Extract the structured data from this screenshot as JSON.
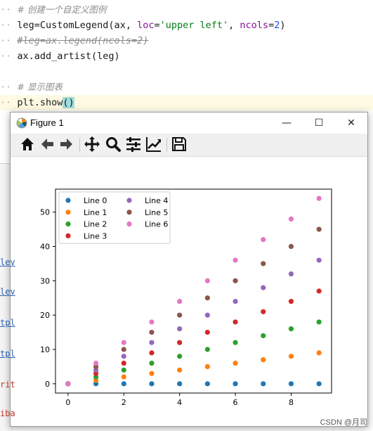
{
  "editor": {
    "lines": [
      {
        "dots": "··",
        "parts": [
          {
            "cls": "c-comment",
            "text": "# 创建一个自定义图例"
          }
        ]
      },
      {
        "dots": "··",
        "parts": [
          {
            "cls": "",
            "text": "leg=CustomLegend(ax, "
          },
          {
            "cls": "c-kw",
            "text": "loc"
          },
          {
            "cls": "",
            "text": "="
          },
          {
            "cls": "c-str",
            "text": "'upper left'"
          },
          {
            "cls": "",
            "text": ", "
          },
          {
            "cls": "c-kw",
            "text": "ncols"
          },
          {
            "cls": "",
            "text": "="
          },
          {
            "cls": "c-num",
            "text": "2"
          },
          {
            "cls": "",
            "text": ")"
          }
        ]
      },
      {
        "dots": "··",
        "parts": [
          {
            "cls": "c-struck",
            "text": "#leg=ax.legend(ncols=2)"
          }
        ]
      },
      {
        "dots": "··",
        "parts": [
          {
            "cls": "",
            "text": "ax.add_artist(leg)"
          }
        ]
      },
      {
        "dots": "",
        "parts": []
      },
      {
        "dots": "··",
        "parts": [
          {
            "cls": "c-comment",
            "text": "# 显示图表"
          }
        ]
      },
      {
        "dots": "··",
        "parts": [
          {
            "cls": "",
            "text": "plt.show"
          },
          {
            "cls": "hl-bg",
            "text": "()"
          }
        ]
      }
    ]
  },
  "side_snippets": [
    {
      "text": "lev",
      "color": "blue"
    },
    {
      "text": "lev",
      "color": "blue"
    },
    {
      "text": "tpl",
      "color": "blue"
    },
    {
      "text": "tpl",
      "color": "blue"
    },
    {
      "text": "rit",
      "color": "red"
    },
    {
      "text": "iba",
      "color": "red"
    }
  ],
  "window": {
    "title": "Figure 1",
    "minimize_label": "—",
    "maximize_label": "☐",
    "close_label": "✕",
    "toolbar_icons": [
      "home-icon",
      "back-arrow-icon",
      "forward-arrow-icon",
      "pan-icon",
      "zoom-icon",
      "subplots-config-icon",
      "edit-axis-icon",
      "save-icon"
    ]
  },
  "chart_data": {
    "type": "scatter",
    "title": "",
    "xlabel": "",
    "ylabel": "",
    "xlim": [
      -0.45,
      9.45
    ],
    "ylim": [
      -2.7,
      56.7
    ],
    "xticks": [
      0,
      2,
      4,
      6,
      8
    ],
    "yticks": [
      0,
      10,
      20,
      30,
      40,
      50
    ],
    "x": [
      0,
      1,
      2,
      3,
      4,
      5,
      6,
      7,
      8,
      9
    ],
    "legend": {
      "placement": "upper left",
      "ncols": 2
    },
    "grid": false,
    "series": [
      {
        "name": "Line 0",
        "color": "#1f77b4",
        "values": [
          0,
          0,
          0,
          0,
          0,
          0,
          0,
          0,
          0,
          0
        ]
      },
      {
        "name": "Line 1",
        "color": "#ff7f0e",
        "values": [
          0,
          1,
          2,
          3,
          4,
          5,
          6,
          7,
          8,
          9
        ]
      },
      {
        "name": "Line 2",
        "color": "#2ca02c",
        "values": [
          0,
          2,
          4,
          6,
          8,
          10,
          12,
          14,
          16,
          18
        ]
      },
      {
        "name": "Line 3",
        "color": "#d62728",
        "values": [
          0,
          3,
          6,
          9,
          12,
          15,
          18,
          21,
          24,
          27
        ]
      },
      {
        "name": "Line 4",
        "color": "#9467bd",
        "values": [
          0,
          4,
          8,
          12,
          16,
          20,
          24,
          28,
          32,
          36
        ]
      },
      {
        "name": "Line 5",
        "color": "#8c564b",
        "values": [
          0,
          5,
          10,
          15,
          20,
          25,
          30,
          35,
          40,
          45
        ]
      },
      {
        "name": "Line 6",
        "color": "#e377c2",
        "values": [
          0,
          6,
          12,
          18,
          24,
          30,
          36,
          42,
          48,
          54
        ]
      }
    ]
  },
  "credit": "CSDN @月司"
}
